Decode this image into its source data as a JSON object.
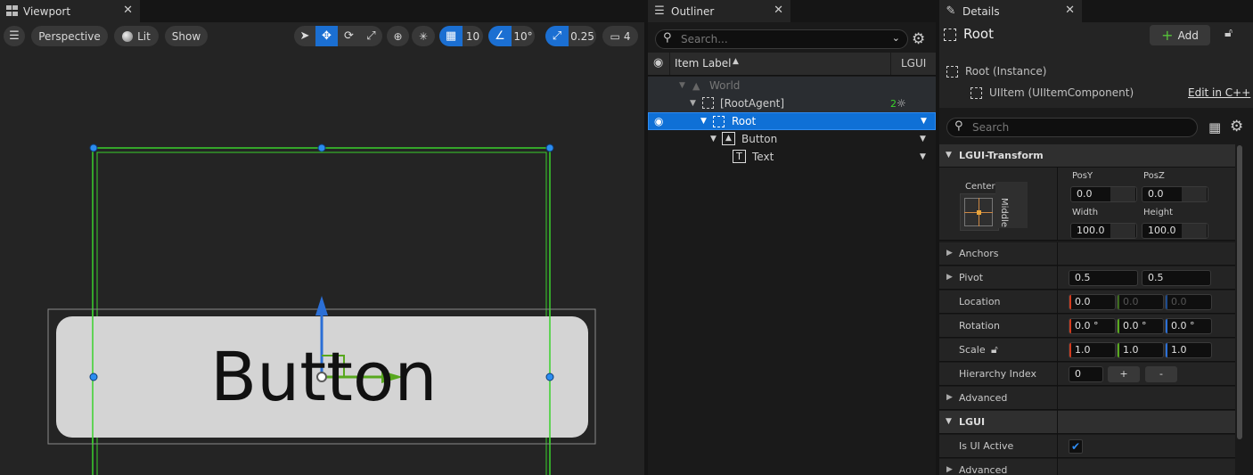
{
  "viewport": {
    "tab_title": "Viewport",
    "perspective_label": "Perspective",
    "lit_label": "Lit",
    "show_label": "Show",
    "grid_snap_value": "10",
    "rotation_snap_value": "10°",
    "scale_snap_value": "0.25",
    "camera_speed_value": "4",
    "scene_button_text": "Button"
  },
  "outliner": {
    "tab_title": "Outliner",
    "search_placeholder": "Search...",
    "col_item_label": "Item Label",
    "col_lgui": "LGUI",
    "rows": [
      {
        "label": "World"
      },
      {
        "label": "[RootAgent]",
        "badge": "2"
      },
      {
        "label": "Root"
      },
      {
        "label": "Button"
      },
      {
        "label": "Text"
      }
    ]
  },
  "details": {
    "tab_title": "Details",
    "object_name": "Root",
    "add_label": "Add",
    "instance_label": "Root (Instance)",
    "component_label": "UIItem (UIItemComponent)",
    "edit_cpp_label": "Edit in C++",
    "search_placeholder": "Search",
    "transform_section": "LGUI-Transform",
    "anchor_h": "Center",
    "anchor_v": "Middle",
    "posy_label": "PosY",
    "posy_value": "0.0",
    "posz_label": "PosZ",
    "posz_value": "0.0",
    "width_label": "Width",
    "width_value": "100.0",
    "height_label": "Height",
    "height_value": "100.0",
    "anchors_label": "Anchors",
    "pivot_label": "Pivot",
    "pivot_x": "0.5",
    "pivot_y": "0.5",
    "location_label": "Location",
    "location": [
      "0.0",
      "0.0",
      "0.0"
    ],
    "rotation_label": "Rotation",
    "rotation": [
      "0.0 °",
      "0.0 °",
      "0.0 °"
    ],
    "scale_label": "Scale",
    "scale": [
      "1.0",
      "1.0",
      "1.0"
    ],
    "hierarchy_label": "Hierarchy Index",
    "hierarchy_value": "0",
    "plus_label": "+",
    "minus_label": "-",
    "advanced_label": "Advanced",
    "lgui_section": "LGUI",
    "is_ui_active_label": "Is UI Active",
    "is_ui_active": true,
    "advanced2_label": "Advanced"
  },
  "colors": {
    "accent": "#0f70d6",
    "axis_x": "#d23b1e",
    "axis_y": "#58a81e",
    "axis_z": "#2b6fd6",
    "selection_green": "#3ad12c"
  }
}
